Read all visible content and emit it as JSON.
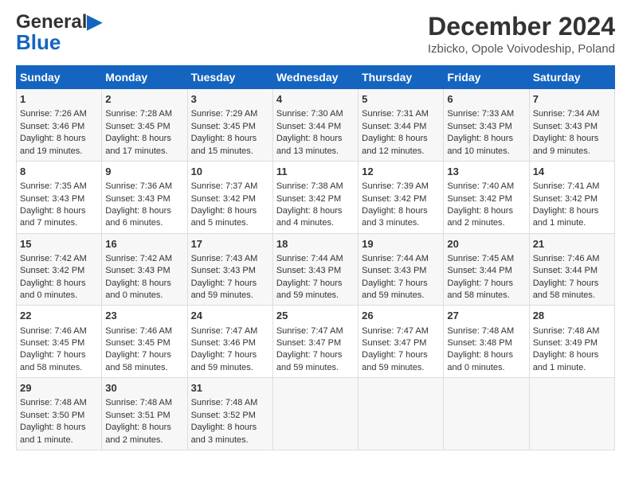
{
  "logo": {
    "line1": "General",
    "line2": "Blue"
  },
  "title": "December 2024",
  "subtitle": "Izbicko, Opole Voivodeship, Poland",
  "days_of_week": [
    "Sunday",
    "Monday",
    "Tuesday",
    "Wednesday",
    "Thursday",
    "Friday",
    "Saturday"
  ],
  "weeks": [
    [
      {
        "day": "1",
        "lines": [
          "Sunrise: 7:26 AM",
          "Sunset: 3:46 PM",
          "Daylight: 8 hours",
          "and 19 minutes."
        ]
      },
      {
        "day": "2",
        "lines": [
          "Sunrise: 7:28 AM",
          "Sunset: 3:45 PM",
          "Daylight: 8 hours",
          "and 17 minutes."
        ]
      },
      {
        "day": "3",
        "lines": [
          "Sunrise: 7:29 AM",
          "Sunset: 3:45 PM",
          "Daylight: 8 hours",
          "and 15 minutes."
        ]
      },
      {
        "day": "4",
        "lines": [
          "Sunrise: 7:30 AM",
          "Sunset: 3:44 PM",
          "Daylight: 8 hours",
          "and 13 minutes."
        ]
      },
      {
        "day": "5",
        "lines": [
          "Sunrise: 7:31 AM",
          "Sunset: 3:44 PM",
          "Daylight: 8 hours",
          "and 12 minutes."
        ]
      },
      {
        "day": "6",
        "lines": [
          "Sunrise: 7:33 AM",
          "Sunset: 3:43 PM",
          "Daylight: 8 hours",
          "and 10 minutes."
        ]
      },
      {
        "day": "7",
        "lines": [
          "Sunrise: 7:34 AM",
          "Sunset: 3:43 PM",
          "Daylight: 8 hours",
          "and 9 minutes."
        ]
      }
    ],
    [
      {
        "day": "8",
        "lines": [
          "Sunrise: 7:35 AM",
          "Sunset: 3:43 PM",
          "Daylight: 8 hours",
          "and 7 minutes."
        ]
      },
      {
        "day": "9",
        "lines": [
          "Sunrise: 7:36 AM",
          "Sunset: 3:43 PM",
          "Daylight: 8 hours",
          "and 6 minutes."
        ]
      },
      {
        "day": "10",
        "lines": [
          "Sunrise: 7:37 AM",
          "Sunset: 3:42 PM",
          "Daylight: 8 hours",
          "and 5 minutes."
        ]
      },
      {
        "day": "11",
        "lines": [
          "Sunrise: 7:38 AM",
          "Sunset: 3:42 PM",
          "Daylight: 8 hours",
          "and 4 minutes."
        ]
      },
      {
        "day": "12",
        "lines": [
          "Sunrise: 7:39 AM",
          "Sunset: 3:42 PM",
          "Daylight: 8 hours",
          "and 3 minutes."
        ]
      },
      {
        "day": "13",
        "lines": [
          "Sunrise: 7:40 AM",
          "Sunset: 3:42 PM",
          "Daylight: 8 hours",
          "and 2 minutes."
        ]
      },
      {
        "day": "14",
        "lines": [
          "Sunrise: 7:41 AM",
          "Sunset: 3:42 PM",
          "Daylight: 8 hours",
          "and 1 minute."
        ]
      }
    ],
    [
      {
        "day": "15",
        "lines": [
          "Sunrise: 7:42 AM",
          "Sunset: 3:42 PM",
          "Daylight: 8 hours",
          "and 0 minutes."
        ]
      },
      {
        "day": "16",
        "lines": [
          "Sunrise: 7:42 AM",
          "Sunset: 3:43 PM",
          "Daylight: 8 hours",
          "and 0 minutes."
        ]
      },
      {
        "day": "17",
        "lines": [
          "Sunrise: 7:43 AM",
          "Sunset: 3:43 PM",
          "Daylight: 7 hours",
          "and 59 minutes."
        ]
      },
      {
        "day": "18",
        "lines": [
          "Sunrise: 7:44 AM",
          "Sunset: 3:43 PM",
          "Daylight: 7 hours",
          "and 59 minutes."
        ]
      },
      {
        "day": "19",
        "lines": [
          "Sunrise: 7:44 AM",
          "Sunset: 3:43 PM",
          "Daylight: 7 hours",
          "and 59 minutes."
        ]
      },
      {
        "day": "20",
        "lines": [
          "Sunrise: 7:45 AM",
          "Sunset: 3:44 PM",
          "Daylight: 7 hours",
          "and 58 minutes."
        ]
      },
      {
        "day": "21",
        "lines": [
          "Sunrise: 7:46 AM",
          "Sunset: 3:44 PM",
          "Daylight: 7 hours",
          "and 58 minutes."
        ]
      }
    ],
    [
      {
        "day": "22",
        "lines": [
          "Sunrise: 7:46 AM",
          "Sunset: 3:45 PM",
          "Daylight: 7 hours",
          "and 58 minutes."
        ]
      },
      {
        "day": "23",
        "lines": [
          "Sunrise: 7:46 AM",
          "Sunset: 3:45 PM",
          "Daylight: 7 hours",
          "and 58 minutes."
        ]
      },
      {
        "day": "24",
        "lines": [
          "Sunrise: 7:47 AM",
          "Sunset: 3:46 PM",
          "Daylight: 7 hours",
          "and 59 minutes."
        ]
      },
      {
        "day": "25",
        "lines": [
          "Sunrise: 7:47 AM",
          "Sunset: 3:47 PM",
          "Daylight: 7 hours",
          "and 59 minutes."
        ]
      },
      {
        "day": "26",
        "lines": [
          "Sunrise: 7:47 AM",
          "Sunset: 3:47 PM",
          "Daylight: 7 hours",
          "and 59 minutes."
        ]
      },
      {
        "day": "27",
        "lines": [
          "Sunrise: 7:48 AM",
          "Sunset: 3:48 PM",
          "Daylight: 8 hours",
          "and 0 minutes."
        ]
      },
      {
        "day": "28",
        "lines": [
          "Sunrise: 7:48 AM",
          "Sunset: 3:49 PM",
          "Daylight: 8 hours",
          "and 1 minute."
        ]
      }
    ],
    [
      {
        "day": "29",
        "lines": [
          "Sunrise: 7:48 AM",
          "Sunset: 3:50 PM",
          "Daylight: 8 hours",
          "and 1 minute."
        ]
      },
      {
        "day": "30",
        "lines": [
          "Sunrise: 7:48 AM",
          "Sunset: 3:51 PM",
          "Daylight: 8 hours",
          "and 2 minutes."
        ]
      },
      {
        "day": "31",
        "lines": [
          "Sunrise: 7:48 AM",
          "Sunset: 3:52 PM",
          "Daylight: 8 hours",
          "and 3 minutes."
        ]
      },
      null,
      null,
      null,
      null
    ]
  ]
}
